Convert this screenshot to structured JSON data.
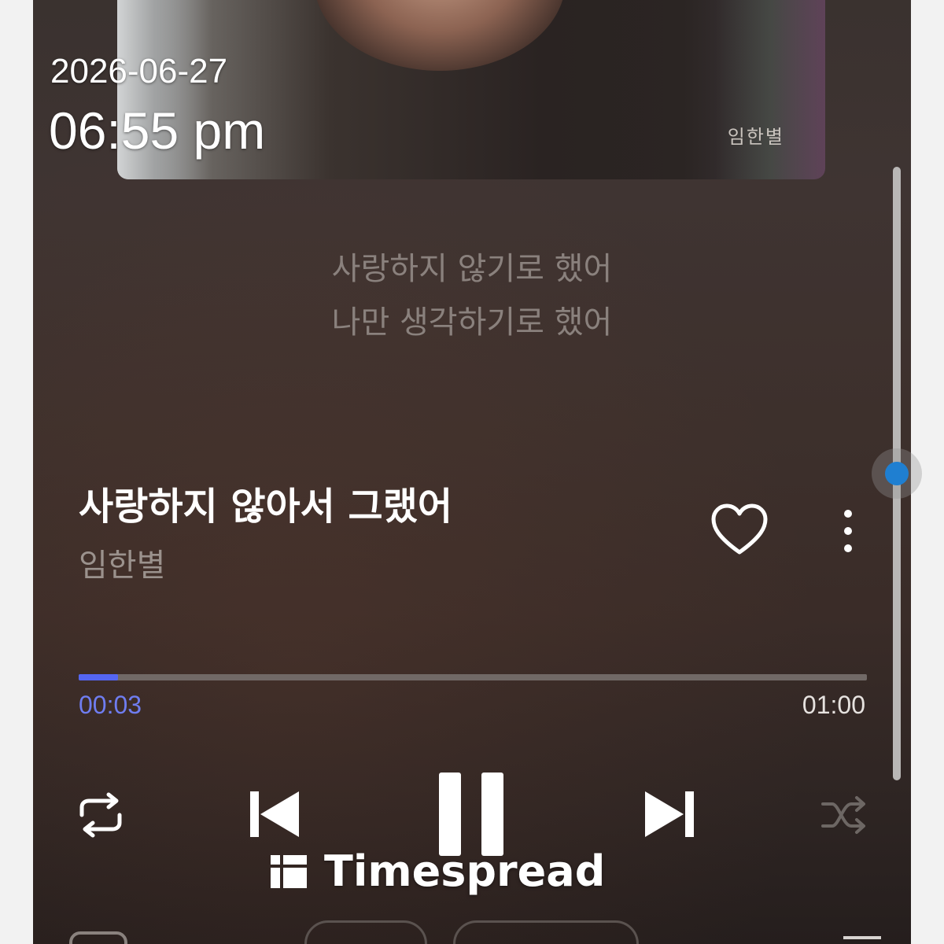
{
  "overlay": {
    "date": "2026-06-27",
    "time": "06:55 pm",
    "watermark": "Timespread"
  },
  "album": {
    "artist_mark": "임한별"
  },
  "lyrics": {
    "line1": "사랑하지 않기로 했어",
    "line2": "나만 생각하기로 했어"
  },
  "track": {
    "title": "사랑하지 않아서 그랬어",
    "artist": "임한별"
  },
  "icons": {
    "like": "heart-outline-icon",
    "more": "more-vertical-icon",
    "repeat": "repeat-icon",
    "previous": "skip-previous-icon",
    "play_pause": "pause-icon",
    "next": "skip-next-icon",
    "shuffle": "shuffle-icon",
    "logo": "timespread-logo-icon"
  },
  "progress": {
    "current": "00:03",
    "total": "01:00",
    "fraction": 0.05
  },
  "colors": {
    "accent": "#5466f2",
    "current_time": "#6f7df0",
    "scroll_handle": "#1f7fd1"
  }
}
